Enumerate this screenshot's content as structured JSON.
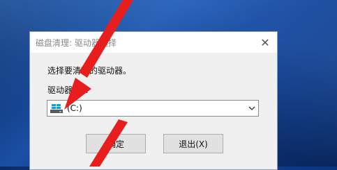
{
  "dialog": {
    "title": "磁盘清理: 驱动器选择",
    "close_symbol": "✕",
    "prompt": "选择要清理的驱动器。",
    "drive_label": "驱动器(D):",
    "drive_select": {
      "value": "(C:)",
      "icon": "drive-icon"
    },
    "ok_label": "确定",
    "exit_label": "退出(X)"
  },
  "annotation": {
    "type": "red-arrow-pointer",
    "color": "#e81d1d"
  }
}
